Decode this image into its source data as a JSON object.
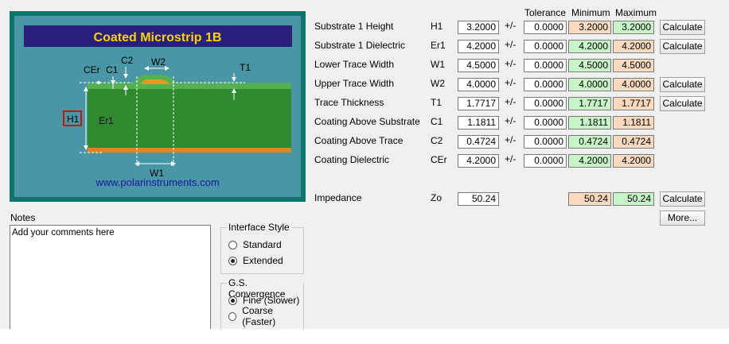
{
  "diagram": {
    "title": "Coated Microstrip 1B",
    "url": "www.polarinstruments.com",
    "labels": {
      "cer": "CEr",
      "c1": "C1",
      "c2": "C2",
      "w2": "W2",
      "t1": "T1",
      "h1": "H1",
      "er1": "Er1",
      "w1": "W1"
    }
  },
  "notes": {
    "label": "Notes",
    "value": "Add your comments here"
  },
  "interface_style": {
    "legend": "Interface Style",
    "options": [
      "Standard",
      "Extended"
    ],
    "selected": "Extended"
  },
  "convergence": {
    "legend": "G.S. Convergence",
    "options": [
      "Fine (Slower)",
      "Coarse (Faster)"
    ],
    "selected": "Fine (Slower)"
  },
  "columns": {
    "tolerance": "Tolerance",
    "minimum": "Minimum",
    "maximum": "Maximum"
  },
  "pm": "+/-",
  "params": [
    {
      "label": "Substrate 1 Height",
      "sym": "H1",
      "value": "3.2000",
      "tol": "0.0000",
      "min": "3.2000",
      "max": "3.2000",
      "min_color": "peach",
      "max_color": "green",
      "button": "Calculate"
    },
    {
      "label": "Substrate 1 Dielectric",
      "sym": "Er1",
      "value": "4.2000",
      "tol": "0.0000",
      "min": "4.2000",
      "max": "4.2000",
      "min_color": "green",
      "max_color": "peach",
      "button": "Calculate"
    },
    {
      "label": "Lower Trace Width",
      "sym": "W1",
      "value": "4.5000",
      "tol": "0.0000",
      "min": "4.5000",
      "max": "4.5000",
      "min_color": "green",
      "max_color": "peach",
      "button": ""
    },
    {
      "label": "Upper Trace Width",
      "sym": "W2",
      "value": "4.0000",
      "tol": "0.0000",
      "min": "4.0000",
      "max": "4.0000",
      "min_color": "green",
      "max_color": "peach",
      "button": "Calculate"
    },
    {
      "label": "Trace Thickness",
      "sym": "T1",
      "value": "1.7717",
      "tol": "0.0000",
      "min": "1.7717",
      "max": "1.7717",
      "min_color": "green",
      "max_color": "peach",
      "button": "Calculate"
    },
    {
      "label": "Coating Above Substrate",
      "sym": "C1",
      "value": "1.1811",
      "tol": "0.0000",
      "min": "1.1811",
      "max": "1.1811",
      "min_color": "green",
      "max_color": "peach",
      "button": ""
    },
    {
      "label": "Coating Above Trace",
      "sym": "C2",
      "value": "0.4724",
      "tol": "0.0000",
      "min": "0.4724",
      "max": "0.4724",
      "min_color": "green",
      "max_color": "peach",
      "button": ""
    },
    {
      "label": "Coating Dielectric",
      "sym": "CEr",
      "value": "4.2000",
      "tol": "0.0000",
      "min": "4.2000",
      "max": "4.2000",
      "min_color": "green",
      "max_color": "peach",
      "button": ""
    }
  ],
  "impedance": {
    "label": "Impedance",
    "sym": "Zo",
    "value": "50.24",
    "min": "50.24",
    "max": "50.24",
    "button": "Calculate",
    "more": "More..."
  },
  "colors": {
    "green": "#c8f5c8",
    "peach": "#fbd9bf",
    "diagram_border": "#0d766b",
    "diagram_bg": "#4896a6",
    "title_band": "#28207a",
    "title_text": "#ffd200"
  }
}
